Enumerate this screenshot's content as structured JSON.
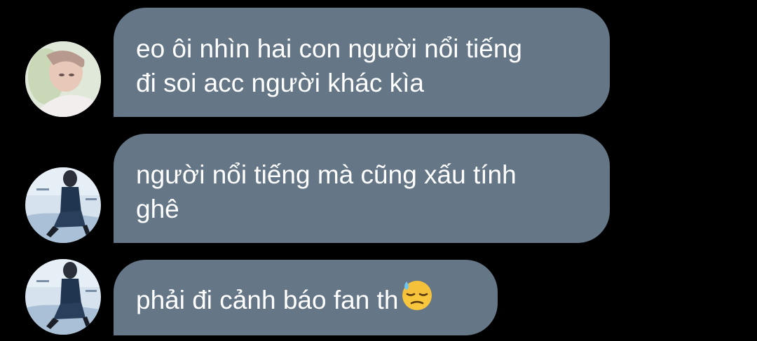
{
  "messages": [
    {
      "avatar": "avatar-soft-portrait",
      "lines": [
        "eo ôi nhìn hai con người nổi tiếng",
        "đi soi acc người khác kìa"
      ]
    },
    {
      "avatar": "avatar-stage-photo",
      "lines": [
        "người nổi tiếng mà cũng xấu tính",
        "ghê"
      ]
    },
    {
      "avatar": "avatar-stage-photo",
      "lines": [
        "phải đi cảnh báo fan th"
      ],
      "emoji": "downcast-face-with-sweat-emoji"
    }
  ],
  "colors": {
    "background": "#000000",
    "bubble": "#657687",
    "text": "#ffffff"
  }
}
